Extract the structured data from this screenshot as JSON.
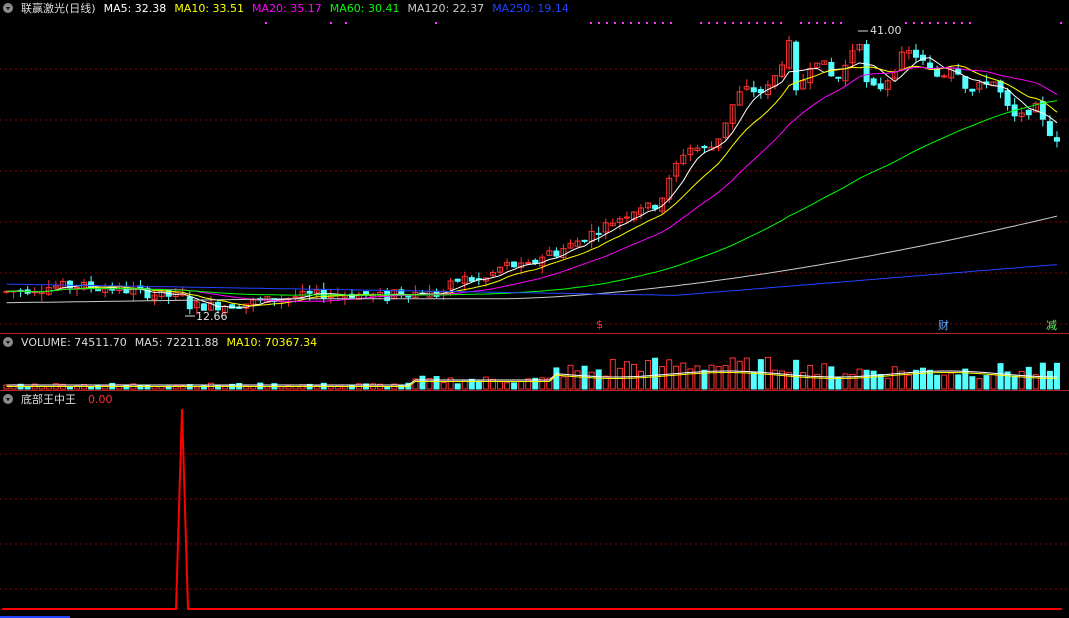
{
  "main_panel": {
    "legend": [
      {
        "key": "title",
        "text": "联赢激光(日线)",
        "color": "#dddddd"
      },
      {
        "key": "ma5",
        "text": "MA5: 32.38",
        "color": "#ffffff"
      },
      {
        "key": "ma10",
        "text": "MA10: 33.51",
        "color": "#ffff00"
      },
      {
        "key": "ma20",
        "text": "MA20: 35.17",
        "color": "#ff00ff"
      },
      {
        "key": "ma60",
        "text": "MA60: 30.41",
        "color": "#00ff00"
      },
      {
        "key": "ma120",
        "text": "MA120: 22.37",
        "color": "#cccccc"
      },
      {
        "key": "ma250",
        "text": "MA250: 19.14",
        "color": "#2244ff"
      }
    ],
    "high_label": "41.00",
    "low_label": "12.66",
    "event_markers": [
      {
        "name": "dividend-marker",
        "text": "$",
        "color": "#ff3333"
      },
      {
        "name": "finance-marker",
        "text": "财",
        "color": "#66aaff"
      },
      {
        "name": "reduce-marker",
        "text": "减",
        "color": "#66ee66"
      }
    ]
  },
  "volume_panel": {
    "legend": [
      {
        "key": "volume",
        "text": "VOLUME: 74511.70",
        "color": "#dddddd"
      },
      {
        "key": "ma5",
        "text": "MA5: 72211.88",
        "color": "#dddddd"
      },
      {
        "key": "ma10",
        "text": "MA10: 70367.34",
        "color": "#ffff00"
      }
    ]
  },
  "indicator_panel": {
    "name": "底部王中王",
    "value": "0.00",
    "value_color": "#ff3333"
  },
  "colors": {
    "up": "#ff3333",
    "down": "#55ffff",
    "grid": "#8b0000",
    "signal": "#ff0000"
  },
  "chart_data": {
    "type": "candlestick",
    "price_range": [
      12.66,
      41.0
    ],
    "moving_averages": [
      "MA5",
      "MA10",
      "MA20",
      "MA60",
      "MA120",
      "MA250"
    ],
    "indicator_peak": 1
  }
}
